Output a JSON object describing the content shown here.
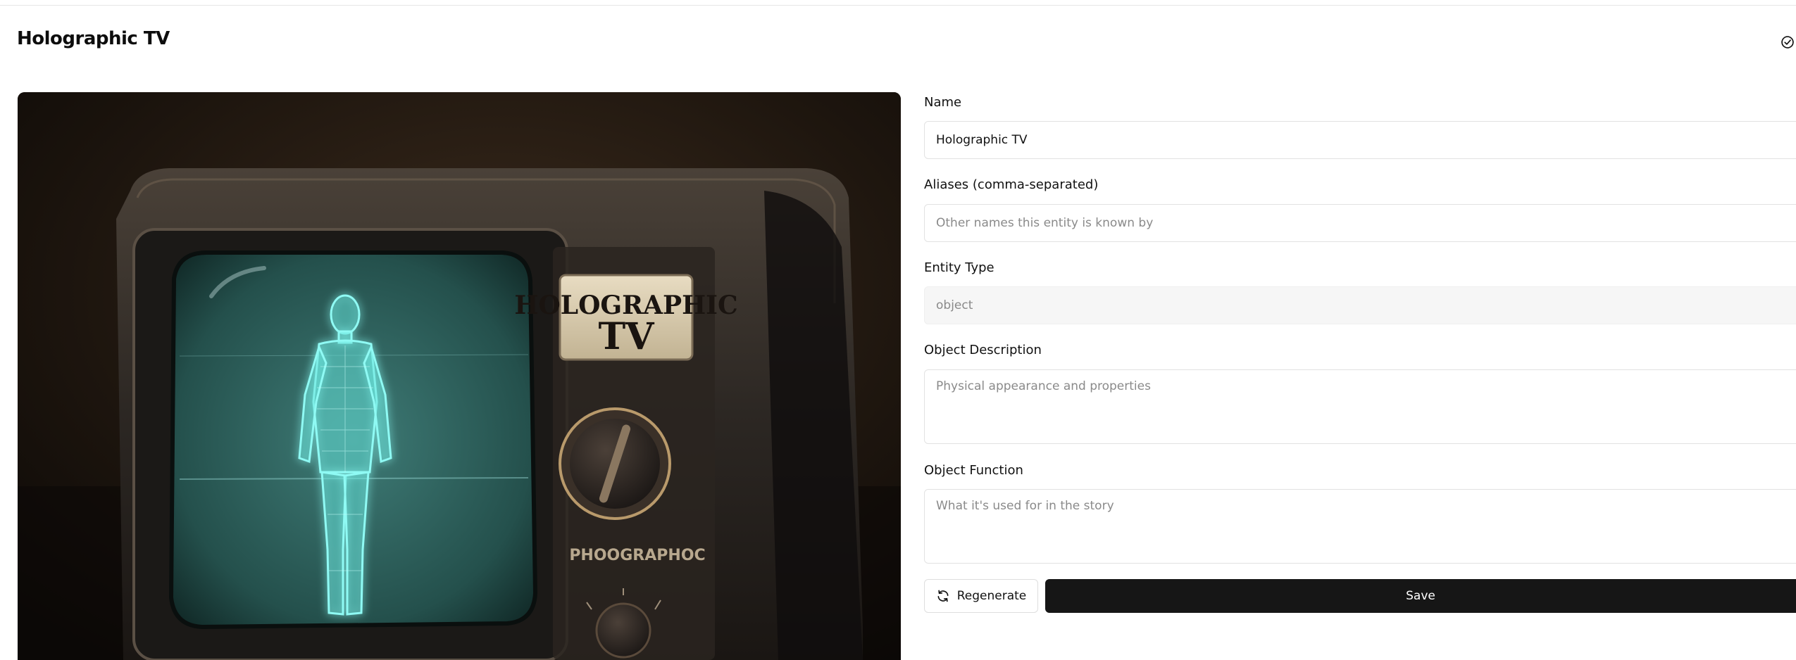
{
  "header": {
    "title": "Holographic TV",
    "status_icon": "check-circle-icon"
  },
  "image": {
    "alt": "Holographic TV",
    "plate_line1": "HOLOGRAPHIC",
    "plate_line2": "TV",
    "brand_text": "PHOOGRAPHOC"
  },
  "form": {
    "name_label": "Name",
    "name_value": "Holographic TV",
    "aliases_label": "Aliases (comma-separated)",
    "aliases_placeholder": "Other names this entity is known by",
    "entity_type_label": "Entity Type",
    "entity_type_value": "object",
    "description_label": "Object Description",
    "description_placeholder": "Physical appearance and properties",
    "function_label": "Object Function",
    "function_placeholder": "What it's used for in the story"
  },
  "actions": {
    "regenerate_label": "Regenerate",
    "regenerate_icon": "refresh-icon",
    "save_label": "Save"
  },
  "colors": {
    "accent": "#161616",
    "hologram": "#7ff5f0",
    "screen": "#2a5a56"
  }
}
